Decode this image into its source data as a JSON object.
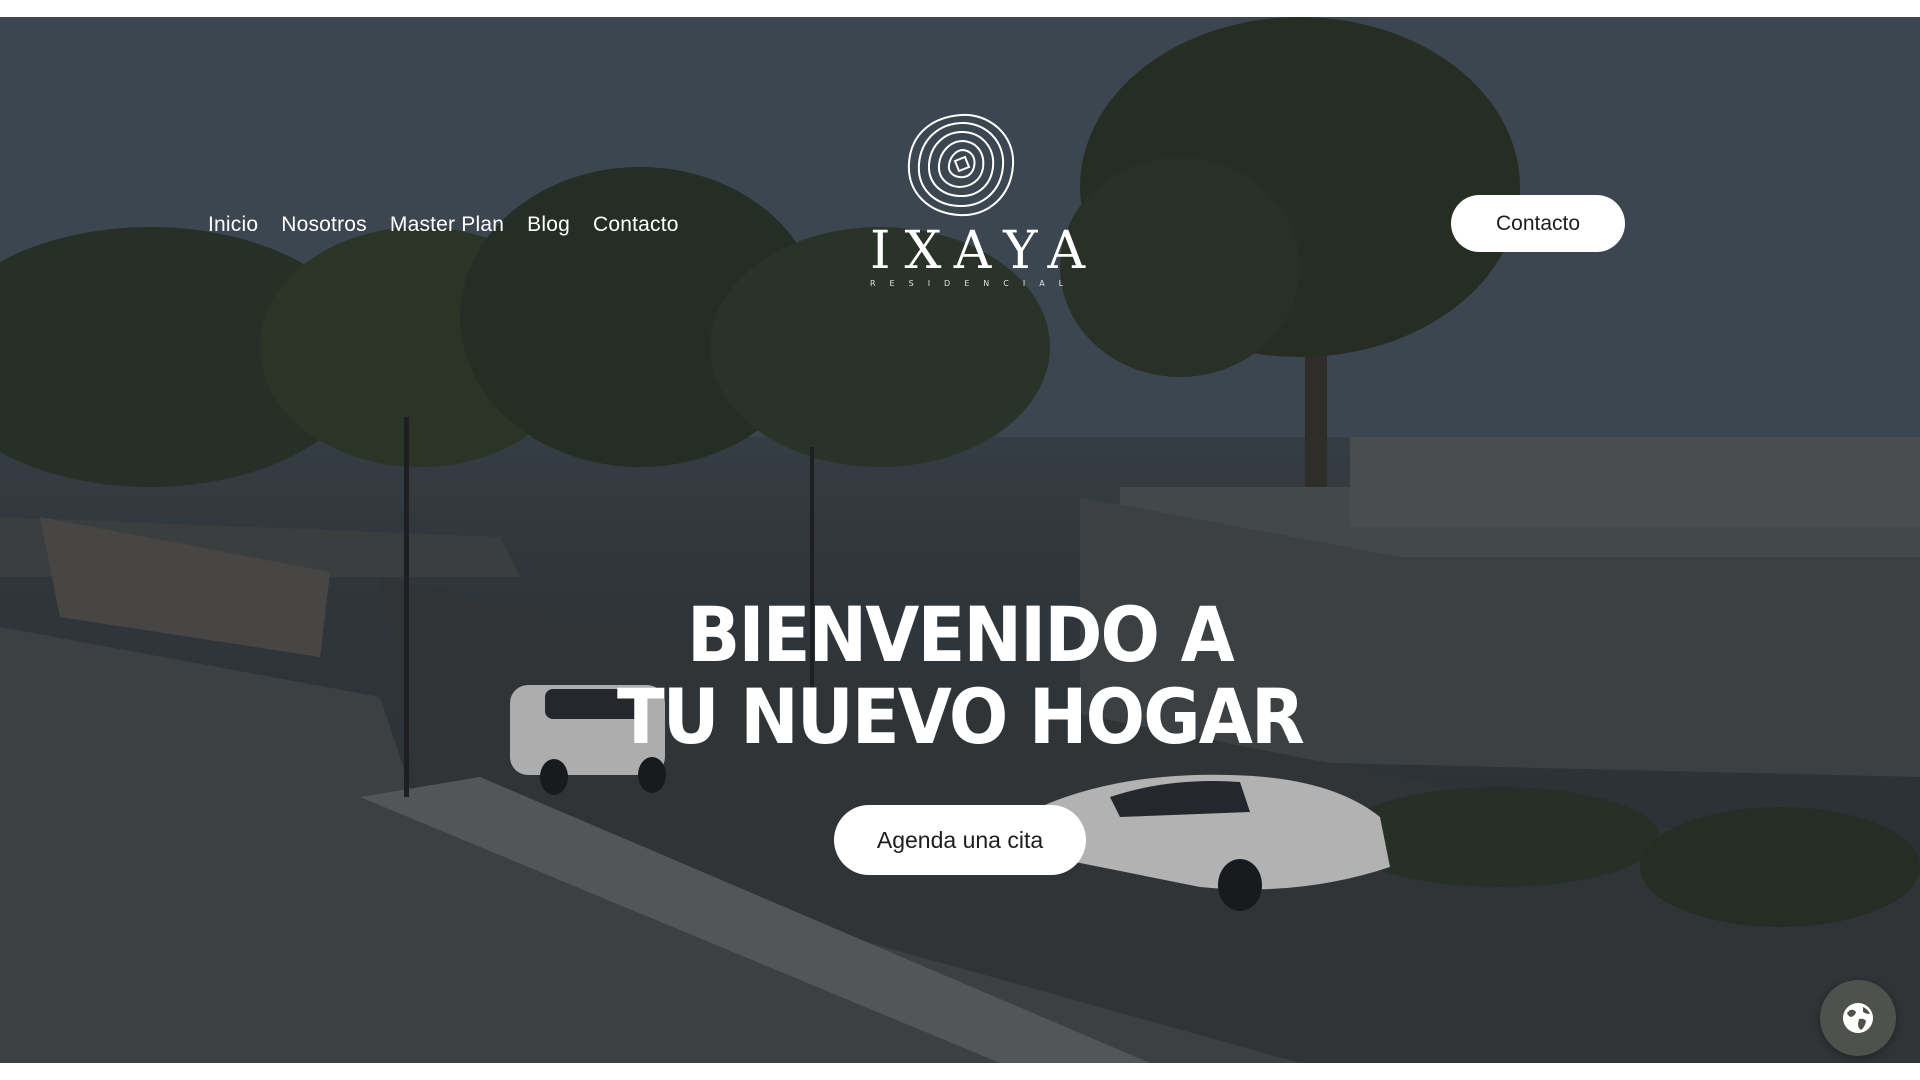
{
  "nav": {
    "items": [
      {
        "label": "Inicio"
      },
      {
        "label": "Nosotros"
      },
      {
        "label": "Master Plan"
      },
      {
        "label": "Blog"
      },
      {
        "label": "Contacto"
      }
    ]
  },
  "logo": {
    "wordmark": "IXAYA",
    "subword": "RESIDENCIAL"
  },
  "header": {
    "cta_label": "Contacto"
  },
  "hero": {
    "headline_line1": "BIENVENIDO A",
    "headline_line2": "TU NUEVO HOGAR",
    "cta_label": "Agenda una cita"
  },
  "language_button": {
    "icon": "globe-icon"
  },
  "colors": {
    "button_bg": "#ffffff",
    "button_text": "#1d1d1d",
    "globe_button_bg": "#4e514c",
    "headline_text": "#ffffff"
  }
}
